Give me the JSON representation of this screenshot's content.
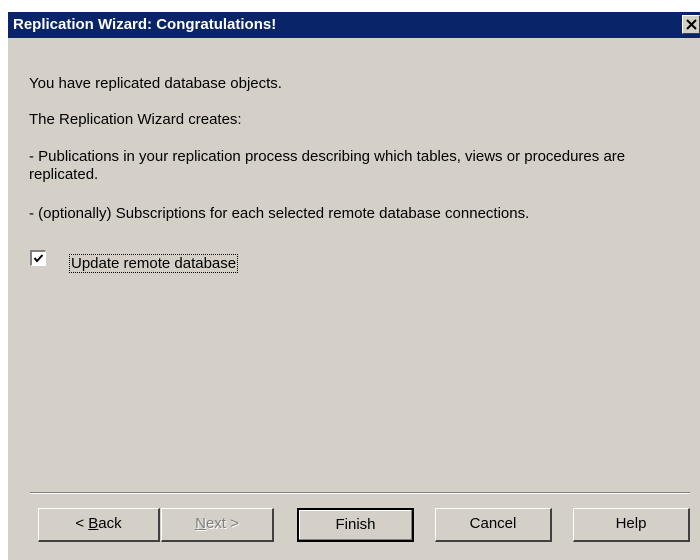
{
  "window": {
    "title": "Replication Wizard: Congratulations!"
  },
  "content": {
    "line1": "You have replicated database objects.",
    "line2": "The Replication Wizard creates:",
    "line3": "- Publications in your replication process describing which tables, views or procedures are replicated.",
    "line4": "- (optionally) Subscriptions for each selected remote database connections."
  },
  "checkbox": {
    "label": "Update remote database",
    "checked": true
  },
  "buttons": {
    "back": {
      "accel": "B",
      "rest": "ack",
      "prefix": "< "
    },
    "next": {
      "accel": "N",
      "rest": "ext >"
    },
    "finish": "Finish",
    "cancel": "Cancel",
    "help": "Help"
  },
  "colors": {
    "titlebar": "#0a246a",
    "face": "#d4d0c8"
  },
  "icons": {
    "close": "close-icon",
    "check": "checkmark-icon"
  }
}
